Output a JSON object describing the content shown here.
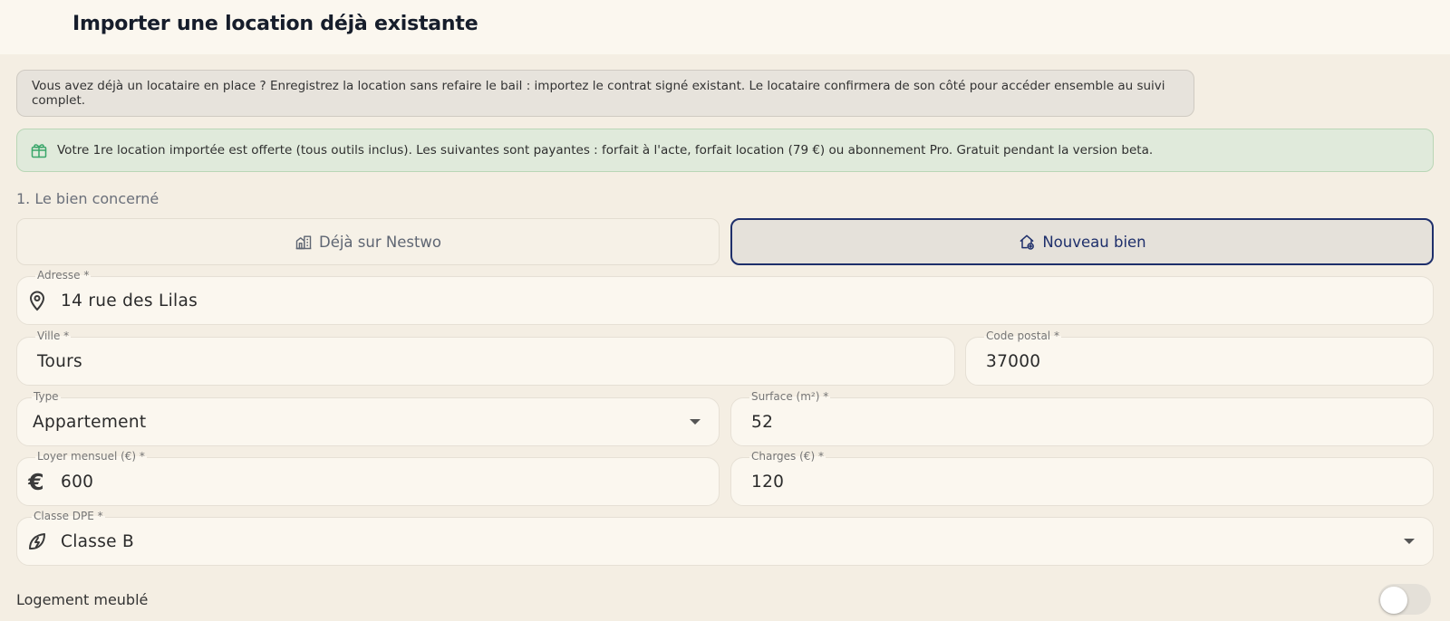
{
  "header": {
    "title": "Importer une location déjà existante"
  },
  "info": {
    "text": "Vous avez déjà un locataire en place ? Enregistrez la location sans refaire le bail : importez le contrat signé existant. Le locataire confirmera de son côté pour accéder ensemble au suivi complet."
  },
  "offer": {
    "icon": "gift-icon",
    "text": "Votre 1re location importée est offerte (tous outils inclus). Les suivantes sont payantes : forfait à l'acte, forfait location (79 €) ou abonnement Pro. Gratuit pendant la version beta."
  },
  "section": {
    "title": "1. Le bien concerné"
  },
  "property_choice": {
    "existing_label": "Déjà sur Nestwo",
    "new_label": "Nouveau bien",
    "selected": "Nouveau bien"
  },
  "form": {
    "address": {
      "label": "Adresse *",
      "value": "14 rue des Lilas"
    },
    "city": {
      "label": "Ville *",
      "value": "Tours"
    },
    "postal_code": {
      "label": "Code postal *",
      "value": "37000"
    },
    "type": {
      "label": "Type",
      "value": "Appartement"
    },
    "surface": {
      "label": "Surface (m²) *",
      "value": "52"
    },
    "rent": {
      "label": "Loyer mensuel (€) *",
      "value": "600"
    },
    "charges": {
      "label": "Charges (€) *",
      "value": "120"
    },
    "dpe": {
      "label": "Classe DPE *",
      "value": "Classe B"
    },
    "furnished": {
      "label": "Logement meublé",
      "checked": false
    }
  },
  "colors": {
    "accent": "#1e2f6b",
    "offer_bg": "#e0eadb",
    "offer_icon": "#3aa66a"
  }
}
